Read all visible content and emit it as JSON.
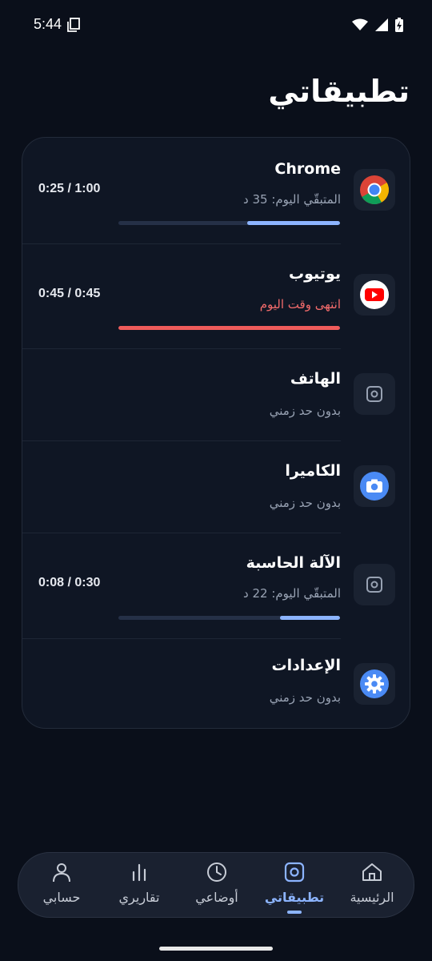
{
  "status_bar": {
    "time": "5:44"
  },
  "header": {
    "title": "تطبيقاتي"
  },
  "apps": [
    {
      "name": "Chrome",
      "subtitle": "المتبقّي اليوم: 35 د",
      "usage": "0:25 / 1:00",
      "progress": 0.42,
      "status": "remaining",
      "icon": "chrome-icon"
    },
    {
      "name": "يوتيوب",
      "subtitle": "انتهى وقت اليوم",
      "usage": "0:45 / 0:45",
      "progress": 1.0,
      "status": "expired",
      "icon": "youtube-icon"
    },
    {
      "name": "الهاتف",
      "subtitle": "بدون حد زمني",
      "status": "unlimited",
      "icon": "generic-app-icon"
    },
    {
      "name": "الكاميرا",
      "subtitle": "بدون حد زمني",
      "status": "unlimited",
      "icon": "camera-icon"
    },
    {
      "name": "الآلة الحاسبة",
      "subtitle": "المتبقّي اليوم: 22 د",
      "usage": "0:08 / 0:30",
      "progress": 0.27,
      "status": "remaining",
      "icon": "generic-app-icon"
    },
    {
      "name": "الإعدادات",
      "subtitle": "بدون حد زمني",
      "status": "unlimited",
      "icon": "settings-gear-icon"
    }
  ],
  "bottom_nav": {
    "items": [
      {
        "label": "الرئيسية",
        "icon": "home-icon"
      },
      {
        "label": "تطبيقاتي",
        "icon": "apps-icon",
        "active": true
      },
      {
        "label": "أوضاعي",
        "icon": "clock-icon"
      },
      {
        "label": "تقاريري",
        "icon": "bar-chart-icon"
      },
      {
        "label": "حسابي",
        "icon": "person-icon"
      }
    ]
  },
  "colors": {
    "background": "#0a0f1a",
    "card": "#0f1624",
    "accent": "#8cb4ff",
    "expired": "#ef5b5b",
    "muted_text": "#98a2b3"
  }
}
